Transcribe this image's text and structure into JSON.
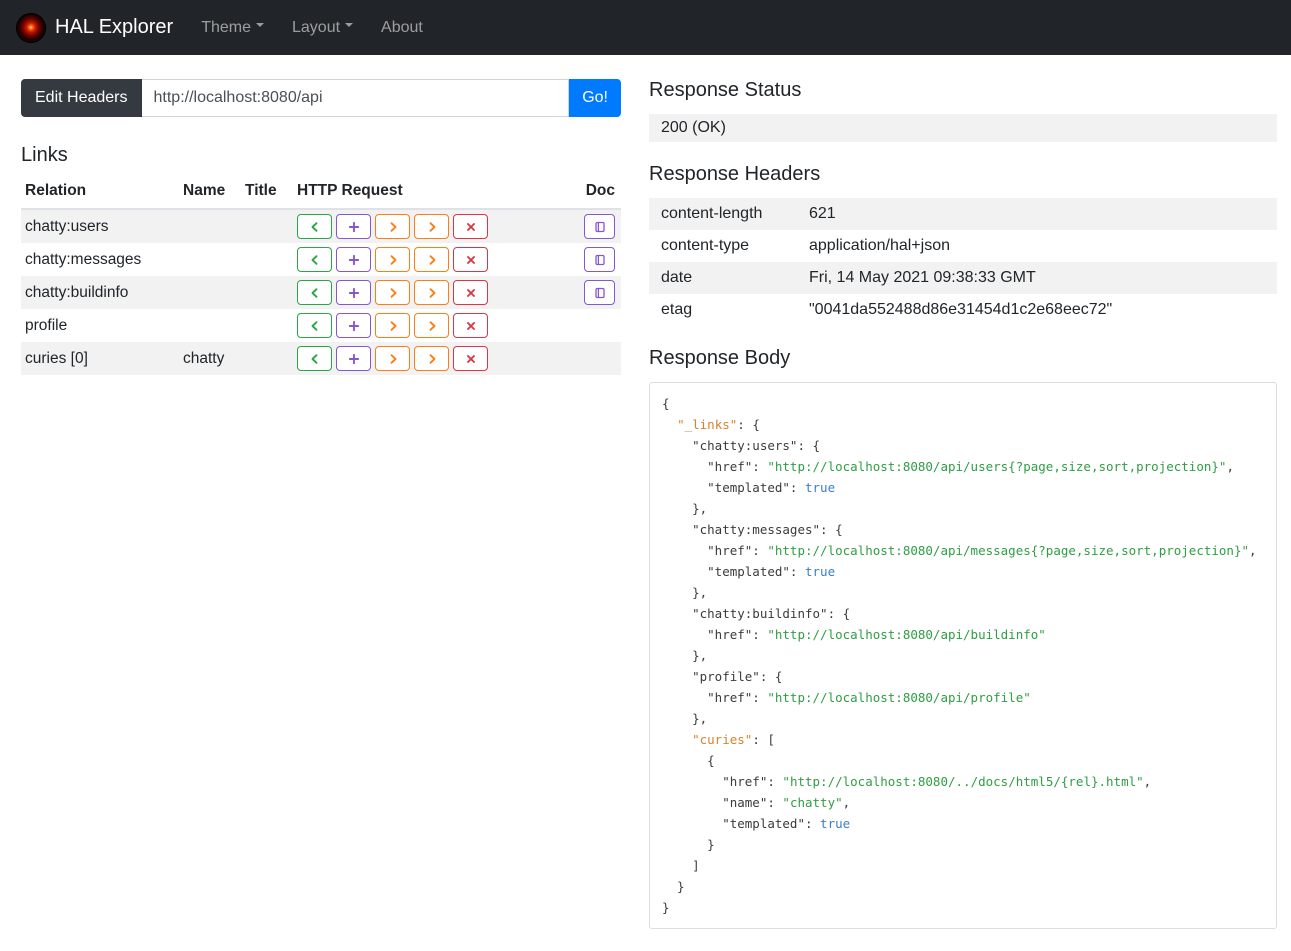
{
  "navbar": {
    "brand": "HAL Explorer",
    "menus": [
      {
        "label": "Theme",
        "caret": true
      },
      {
        "label": "Layout",
        "caret": true
      },
      {
        "label": "About",
        "caret": false
      }
    ]
  },
  "address_bar": {
    "edit_headers": "Edit Headers",
    "url": "http://localhost:8080/api",
    "go": "Go!"
  },
  "links": {
    "title": "Links",
    "columns": {
      "relation": "Relation",
      "name": "Name",
      "title": "Title",
      "http_request": "HTTP Request",
      "doc": "Doc"
    },
    "request_buttons": [
      {
        "name": "get",
        "icon": "chevron-left-icon",
        "color": "#28a745"
      },
      {
        "name": "post",
        "icon": "plus-icon",
        "color": "#8757d1"
      },
      {
        "name": "put",
        "icon": "chevron-right-icon",
        "color": "#fd7e14"
      },
      {
        "name": "patch",
        "icon": "chevron-right-icon",
        "color": "#fd7e14"
      },
      {
        "name": "delete",
        "icon": "x-icon",
        "color": "#dc3545"
      }
    ],
    "doc_button": {
      "icon": "book-icon",
      "color": "#8757d1"
    },
    "rows": [
      {
        "relation": "chatty:users",
        "name": "",
        "title": "",
        "doc": true
      },
      {
        "relation": "chatty:messages",
        "name": "",
        "title": "",
        "doc": true
      },
      {
        "relation": "chatty:buildinfo",
        "name": "",
        "title": "",
        "doc": true
      },
      {
        "relation": "profile",
        "name": "",
        "title": "",
        "doc": false
      },
      {
        "relation": "curies [0]",
        "name": "chatty",
        "title": "",
        "doc": false
      }
    ]
  },
  "response_status": {
    "title": "Response Status",
    "value": "200 (OK)"
  },
  "response_headers": {
    "title": "Response Headers",
    "rows": [
      [
        "content-length",
        "621"
      ],
      [
        "content-type",
        "application/hal+json"
      ],
      [
        "date",
        "Fri, 14 May 2021 09:38:33 GMT"
      ],
      [
        "etag",
        "\"0041da552488d86e31454d1c2e68eec72\""
      ]
    ]
  },
  "response_body": {
    "title": "Response Body",
    "lines": [
      [
        [
          "pl",
          "{"
        ]
      ],
      [
        [
          "pl",
          "  "
        ],
        [
          "hk",
          "\"_links\""
        ],
        [
          "pl",
          ": {"
        ]
      ],
      [
        [
          "pl",
          "    \"chatty:users\": {"
        ]
      ],
      [
        [
          "pl",
          "      \"href\": "
        ],
        [
          "st",
          "\"http://localhost:8080/api/users{?page,size,sort,projection}\""
        ],
        [
          "pl",
          ","
        ]
      ],
      [
        [
          "pl",
          "      \"templated\": "
        ],
        [
          "bo",
          "true"
        ]
      ],
      [
        [
          "pl",
          "    },"
        ]
      ],
      [
        [
          "pl",
          "    \"chatty:messages\": {"
        ]
      ],
      [
        [
          "pl",
          "      \"href\": "
        ],
        [
          "st",
          "\"http://localhost:8080/api/messages{?page,size,sort,projection}\""
        ],
        [
          "pl",
          ","
        ]
      ],
      [
        [
          "pl",
          "      \"templated\": "
        ],
        [
          "bo",
          "true"
        ]
      ],
      [
        [
          "pl",
          "    },"
        ]
      ],
      [
        [
          "pl",
          "    \"chatty:buildinfo\": {"
        ]
      ],
      [
        [
          "pl",
          "      \"href\": "
        ],
        [
          "st",
          "\"http://localhost:8080/api/buildinfo\""
        ]
      ],
      [
        [
          "pl",
          "    },"
        ]
      ],
      [
        [
          "pl",
          "    \"profile\": {"
        ]
      ],
      [
        [
          "pl",
          "      \"href\": "
        ],
        [
          "st",
          "\"http://localhost:8080/api/profile\""
        ]
      ],
      [
        [
          "pl",
          "    },"
        ]
      ],
      [
        [
          "pl",
          "    "
        ],
        [
          "hk",
          "\"curies\""
        ],
        [
          "pl",
          ": ["
        ]
      ],
      [
        [
          "pl",
          "      {"
        ]
      ],
      [
        [
          "pl",
          "        \"href\": "
        ],
        [
          "st",
          "\"http://localhost:8080/../docs/html5/{rel}.html\""
        ],
        [
          "pl",
          ","
        ]
      ],
      [
        [
          "pl",
          "        \"name\": "
        ],
        [
          "st",
          "\"chatty\""
        ],
        [
          "pl",
          ","
        ]
      ],
      [
        [
          "pl",
          "        \"templated\": "
        ],
        [
          "bo",
          "true"
        ]
      ],
      [
        [
          "pl",
          "      }"
        ]
      ],
      [
        [
          "pl",
          "    ]"
        ]
      ],
      [
        [
          "pl",
          "  }"
        ]
      ],
      [
        [
          "pl",
          "}"
        ]
      ]
    ]
  },
  "colors": {
    "navbar_bg": "#212529",
    "accent_blue": "#007bff",
    "stripe_bg": "#f2f2f2",
    "get_green": "#28a745",
    "post_purple": "#8757d1",
    "put_orange": "#fd7e14",
    "delete_red": "#dc3545",
    "code_hal_key": "#d9822b",
    "code_string": "#2f9e44",
    "code_bool": "#3d7ec2"
  }
}
